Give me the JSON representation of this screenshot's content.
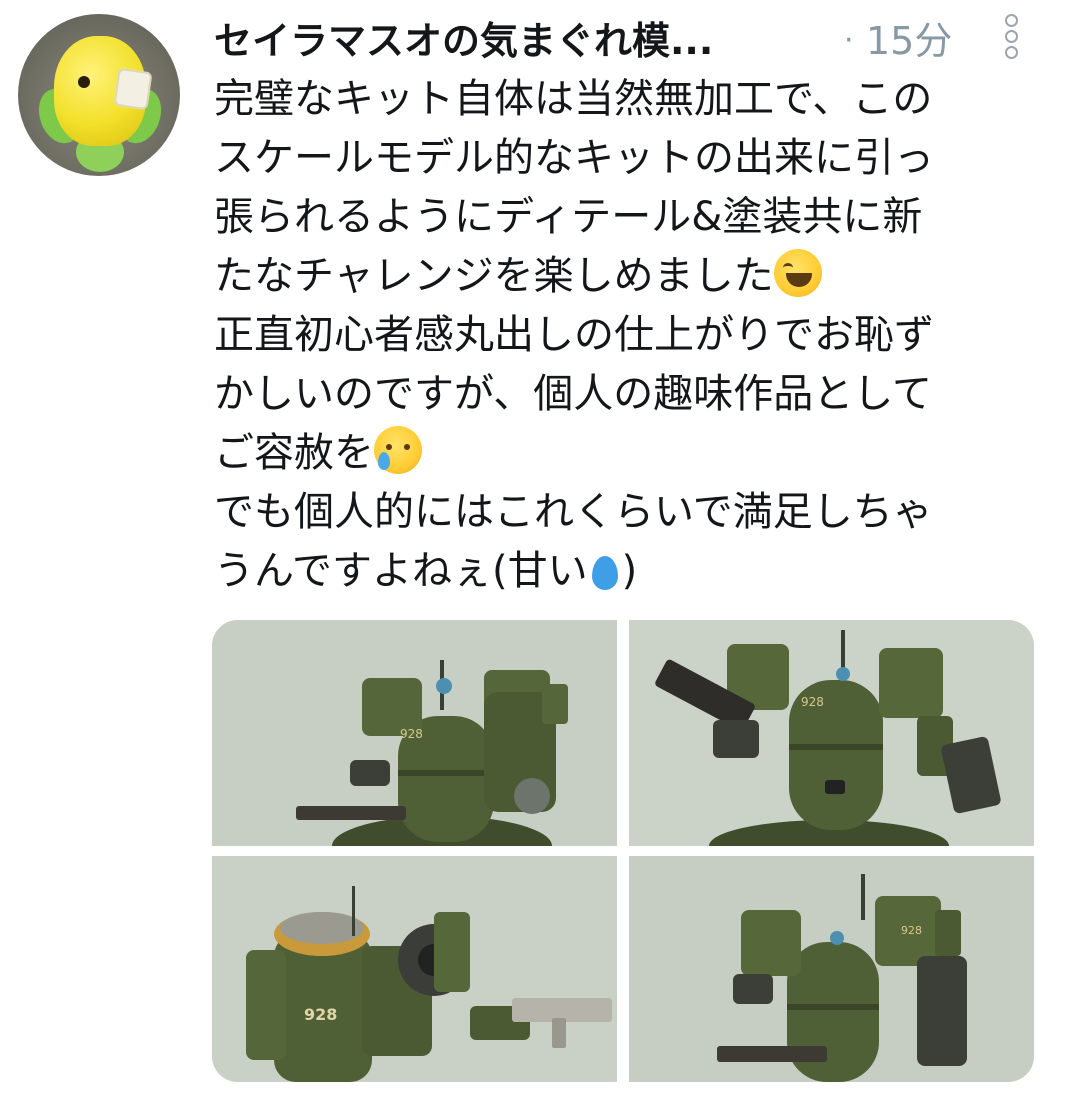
{
  "tweet": {
    "author_name": "セイラマスオの気まぐれ模...",
    "time_separator": "·",
    "time": "15分",
    "text_lines": [
      "完璧なキット自体は当然無加工で、この",
      "スケールモデル的なキットの出来に引っ",
      "張られるようにディテール&塗装共に新",
      "たなチャレンジを楽しめました",
      "正直初心者感丸出しの仕上がりでお恥ず",
      "かしいのですが、個人の趣味作品として",
      "ご容赦を",
      "でも個人的にはこれくらいで満足しちゃ",
      "うんですよねぇ(甘い",
      ")"
    ],
    "emojis": [
      "grinning-squinting-face",
      "sad-but-relieved-face",
      "droplet"
    ],
    "media_count": 4,
    "colors": {
      "text": "#14171a",
      "secondary": "#8899a6",
      "model_green": "#4c5c35",
      "backdrop": "#c4ccc3"
    }
  },
  "images": {
    "labels": [
      "928",
      "928",
      "928",
      "928"
    ]
  }
}
